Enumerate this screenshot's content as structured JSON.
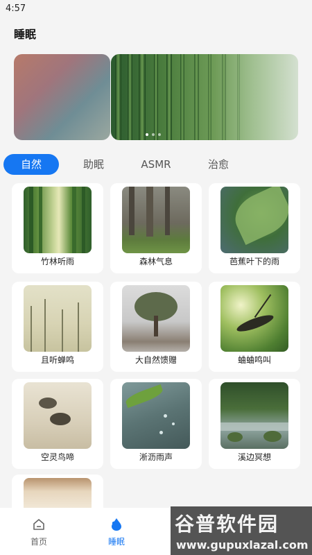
{
  "status_bar": {
    "time": "4:57"
  },
  "header": {
    "title": "睡眠"
  },
  "tabs": [
    {
      "label": "自然",
      "active": true
    },
    {
      "label": "助眠",
      "active": false
    },
    {
      "label": "ASMR",
      "active": false
    },
    {
      "label": "治愈",
      "active": false
    }
  ],
  "cards": [
    {
      "label": "竹林听雨"
    },
    {
      "label": "森林气息"
    },
    {
      "label": "芭蕉叶下的雨"
    },
    {
      "label": "且听蝉鸣"
    },
    {
      "label": "大自然馈赠"
    },
    {
      "label": "蛐蛐鸣叫"
    },
    {
      "label": "空灵鸟啼"
    },
    {
      "label": "淅沥雨声"
    },
    {
      "label": "溪边冥想"
    },
    {
      "label": ""
    }
  ],
  "bottom_nav": [
    {
      "label": "首页",
      "icon": "home-icon",
      "active": false
    },
    {
      "label": "睡眠",
      "icon": "sleep-drop-icon",
      "active": true
    }
  ],
  "watermark": {
    "main": "谷普软件园",
    "sub": "www.gupuxlazal.com"
  },
  "colors": {
    "accent": "#1677f2",
    "background": "#f4f4f4"
  }
}
